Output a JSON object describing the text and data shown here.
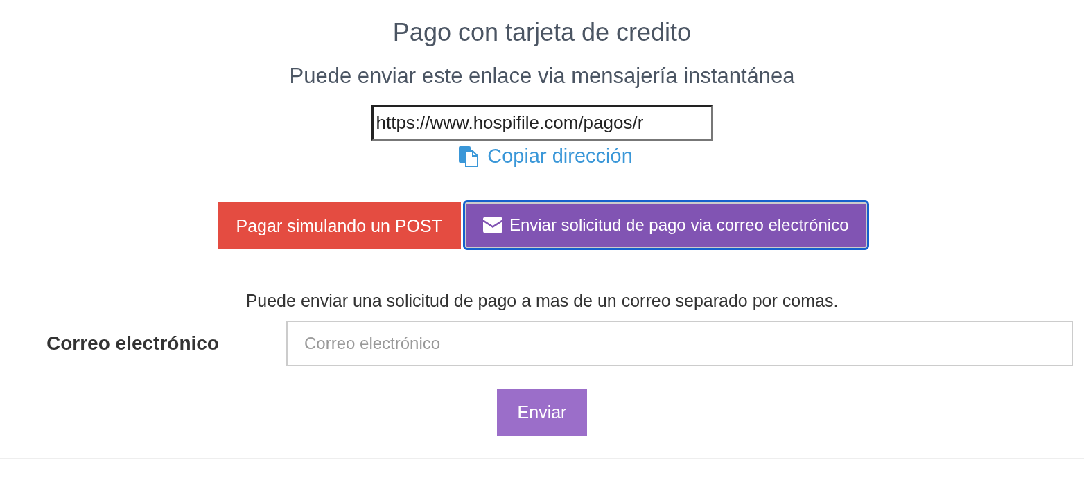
{
  "title": "Pago con tarjeta de credito",
  "subtitle": "Puede enviar este enlace via mensajería instantánea",
  "link_field": {
    "value": "https://www.hospifile.com/pagos/r"
  },
  "copy_link": "Copiar dirección",
  "buttons": [
    {
      "label": "Pagar simulando un POST",
      "kind": "danger",
      "focused": false
    },
    {
      "label": "Enviar solicitud de pago via correo electrónico",
      "kind": "email",
      "focused": true
    }
  ],
  "hint": "Puede enviar una solicitud de pago a mas de un correo separado por comas.",
  "email_field": {
    "label": "Correo electrónico",
    "placeholder": "Correo electrónico"
  },
  "submit": "Enviar"
}
